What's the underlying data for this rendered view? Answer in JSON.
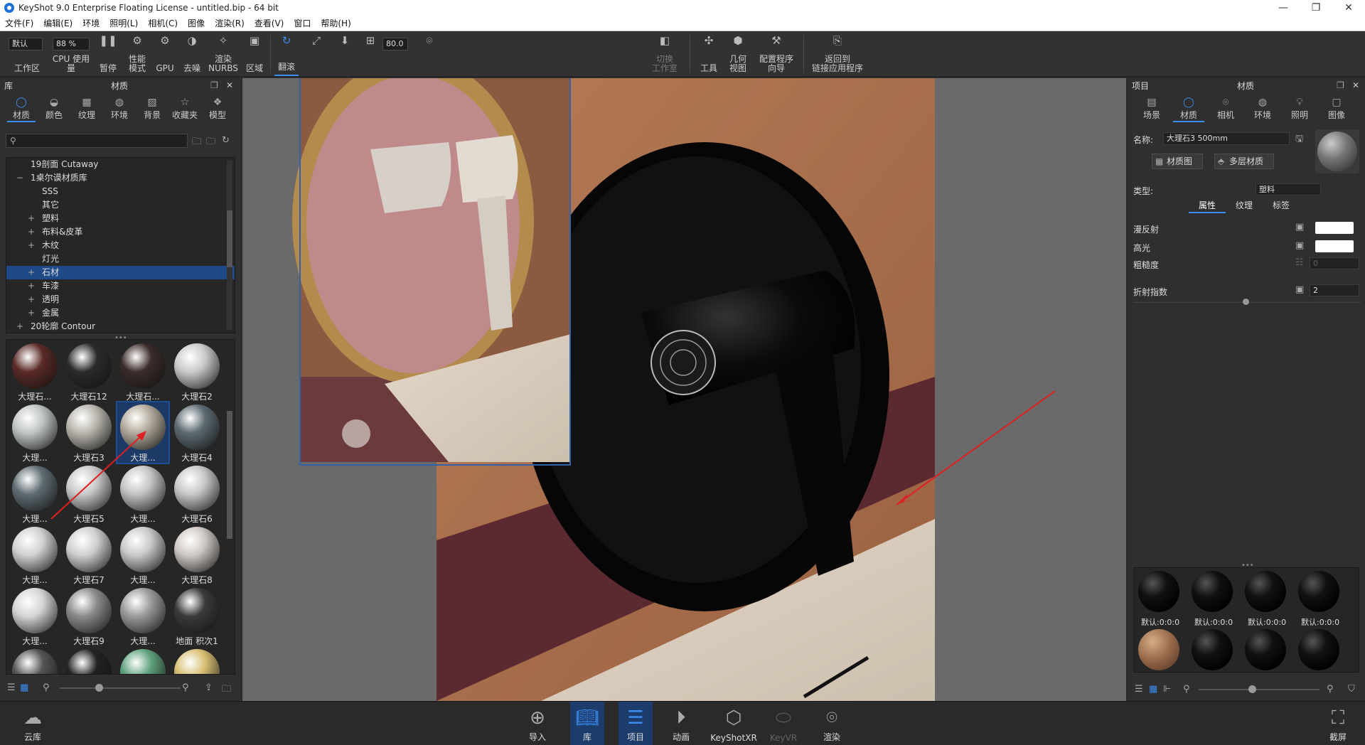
{
  "window": {
    "title": "KeyShot 9.0 Enterprise Floating License  - untitled.bip  - 64 bit",
    "minimize": "—",
    "restore": "❐",
    "close": "✕"
  },
  "menu": [
    "文件(F)",
    "编辑(E)",
    "环境",
    "照明(L)",
    "相机(C)",
    "图像",
    "渲染(R)",
    "查看(V)",
    "窗口",
    "帮助(H)"
  ],
  "toolbar": {
    "preset_value": "默认",
    "cpu_value": "88 %",
    "workspace": "工作区",
    "cpu_usage": "CPU 使用量",
    "pause": "暂停",
    "perf_mode": "性能\n模式",
    "gpu": "GPU",
    "denoise": "去噪",
    "render_nurbs": "渲染\nNURBS",
    "region": "区域",
    "tumble": "翻滚",
    "fov_value": "80.0",
    "switch_workspace": "切换\n工作室",
    "tools": "工具",
    "geometry_view": "几何\n视图",
    "config_wizard": "配置程序\n向导",
    "return_link": "返回到\n链接应用程序"
  },
  "library": {
    "header_left": "库",
    "header_title": "材质",
    "tabs": [
      {
        "label": "材质",
        "icon": "material-icon"
      },
      {
        "label": "颜色",
        "icon": "color-icon"
      },
      {
        "label": "纹理",
        "icon": "texture-icon"
      },
      {
        "label": "环境",
        "icon": "environment-icon"
      },
      {
        "label": "背景",
        "icon": "background-icon"
      },
      {
        "label": "收藏夹",
        "icon": "favorites-icon"
      },
      {
        "label": "模型",
        "icon": "model-icon"
      }
    ],
    "search_placeholder": "",
    "tree": [
      {
        "label": "19剖面 Cutaway",
        "indent": 0,
        "toggle": ""
      },
      {
        "label": "1桌尔谟材质库",
        "indent": 0,
        "toggle": "−"
      },
      {
        "label": "SSS",
        "indent": 1,
        "toggle": ""
      },
      {
        "label": "其它",
        "indent": 1,
        "toggle": ""
      },
      {
        "label": "塑料",
        "indent": 1,
        "toggle": "+"
      },
      {
        "label": "布料&皮革",
        "indent": 1,
        "toggle": "+"
      },
      {
        "label": "木纹",
        "indent": 1,
        "toggle": "+"
      },
      {
        "label": "灯光",
        "indent": 1,
        "toggle": ""
      },
      {
        "label": "石材",
        "indent": 1,
        "toggle": "+",
        "selected": true
      },
      {
        "label": "车漆",
        "indent": 1,
        "toggle": "+"
      },
      {
        "label": "透明",
        "indent": 1,
        "toggle": "+"
      },
      {
        "label": "金属",
        "indent": 1,
        "toggle": "+"
      },
      {
        "label": "20轮廓 Contour",
        "indent": 0,
        "toggle": "+"
      }
    ],
    "thumbs": [
      {
        "label": "大理石...",
        "color": "#5a2a26"
      },
      {
        "label": "大理石12",
        "color": "#2c2a2a"
      },
      {
        "label": "大理石...",
        "color": "#3a2c2a"
      },
      {
        "label": "大理石2",
        "color": "#c8cacb"
      },
      {
        "label": "大理...",
        "color": "#bfc4c2"
      },
      {
        "label": "大理石3",
        "color": "#b9b6ae"
      },
      {
        "label": "大理...",
        "color": "#b3aa9c",
        "selected": true
      },
      {
        "label": "大理石4",
        "color": "#5d6a72"
      },
      {
        "label": "大理...",
        "color": "#5f6c72"
      },
      {
        "label": "大理石5",
        "color": "#c9c9c9"
      },
      {
        "label": "大理...",
        "color": "#c3c3c3"
      },
      {
        "label": "大理石6",
        "color": "#c7c7c7"
      },
      {
        "label": "大理...",
        "color": "#d0d0d0"
      },
      {
        "label": "大理石7",
        "color": "#cfcfcf"
      },
      {
        "label": "大理...",
        "color": "#c8c8c8"
      },
      {
        "label": "大理石8",
        "color": "#cfc8c4"
      },
      {
        "label": "大理...",
        "color": "#d4d4d4"
      },
      {
        "label": "大理石9",
        "color": "#8a8a8a"
      },
      {
        "label": "大理...",
        "color": "#9a9a9a"
      },
      {
        "label": "地面 积次1",
        "color": "#3a3a3a"
      },
      {
        "label": "",
        "color": "#555"
      },
      {
        "label": "",
        "color": "#222"
      },
      {
        "label": "",
        "color": "#5fa27c"
      },
      {
        "label": "",
        "color": "#d8bf72"
      }
    ]
  },
  "project": {
    "header_left": "项目",
    "header_title": "材质",
    "tabs": [
      {
        "label": "场景",
        "icon": "scene-icon"
      },
      {
        "label": "材质",
        "icon": "material-icon"
      },
      {
        "label": "相机",
        "icon": "camera-icon"
      },
      {
        "label": "环境",
        "icon": "environment-icon"
      },
      {
        "label": "照明",
        "icon": "lighting-icon"
      },
      {
        "label": "图像",
        "icon": "image-icon"
      }
    ],
    "name_label": "名称:",
    "name_value": "大理石3 500mm",
    "material_graph": "材质图",
    "multi_material": "多层材质",
    "type_label": "类型:",
    "type_value": "塑料",
    "subtabs": [
      "属性",
      "纹理",
      "标签"
    ],
    "diffuse": "漫反射",
    "specular": "高光",
    "roughness": "粗糙度",
    "roughness_value": "0",
    "ior": "折射指数",
    "ior_value": "2",
    "materials": [
      "默认:0:0:0",
      "默认:0:0:0",
      "默认:0:0:0",
      "默认:0:0:0"
    ]
  },
  "bottom": {
    "cloud": "云库",
    "import": "导入",
    "library": "库",
    "project": "项目",
    "animation": "动画",
    "keyshotxr": "KeyShotXR",
    "keyvr": "KeyVR",
    "render": "渲染",
    "screenshot": "截屏"
  },
  "colors": {
    "accent": "#3b8df0",
    "annotation": "#e02020"
  }
}
